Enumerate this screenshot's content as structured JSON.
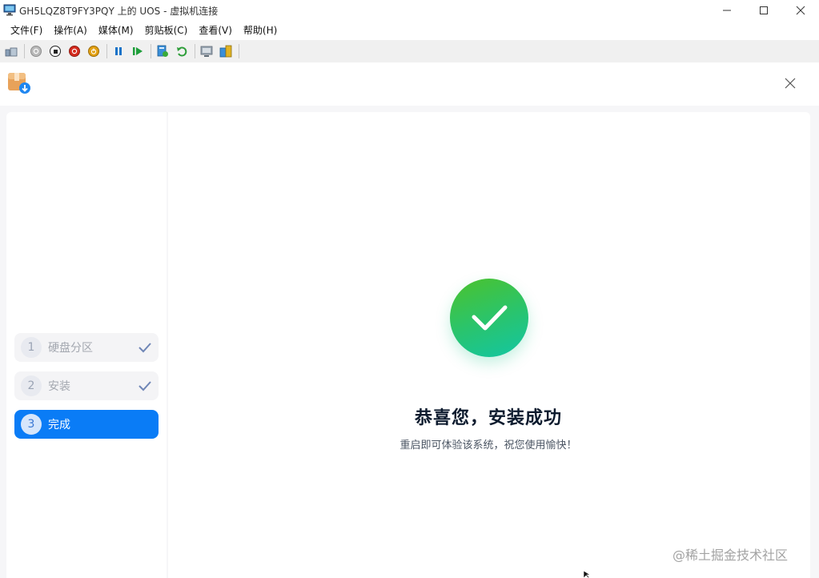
{
  "window": {
    "title": "GH5LQZ8T9FY3PQY 上的 UOS - 虚拟机连接"
  },
  "menu": [
    {
      "label": "文件(F)"
    },
    {
      "label": "操作(A)"
    },
    {
      "label": "媒体(M)"
    },
    {
      "label": "剪贴板(C)"
    },
    {
      "label": "查看(V)"
    },
    {
      "label": "帮助(H)"
    }
  ],
  "toolbar": {
    "icons": [
      "ctrl-alt-del-icon",
      "start-icon",
      "turn-off-icon",
      "shutdown-icon",
      "save-icon",
      "pause-icon",
      "resume-icon",
      "checkpoint-icon",
      "revert-icon",
      "enhanced-session-icon",
      "share-icon"
    ]
  },
  "installer": {
    "steps": [
      {
        "number": "1",
        "label": "硬盘分区",
        "state": "done"
      },
      {
        "number": "2",
        "label": "安装",
        "state": "done"
      },
      {
        "number": "3",
        "label": "完成",
        "state": "active"
      }
    ],
    "success": {
      "title": "恭喜您，安装成功",
      "subtitle": "重启即可体验该系统，祝您使用愉快！"
    },
    "colors": {
      "accent": "#0a7cf6",
      "success_start": "#4cc22b",
      "success_end": "#12c6a4"
    }
  },
  "watermark": "@稀土掘金技术社区"
}
